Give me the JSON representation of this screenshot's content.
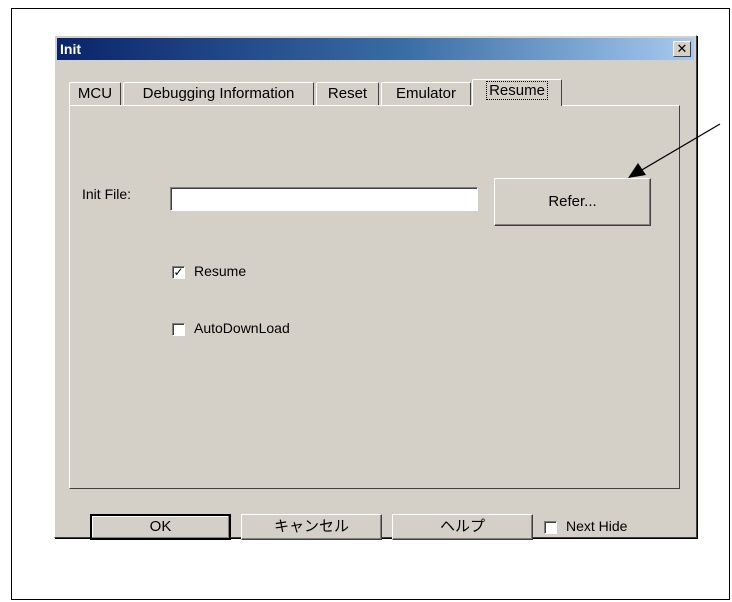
{
  "window": {
    "title": "Init",
    "close_glyph": "✕"
  },
  "tabs": [
    {
      "label": "MCU",
      "active": false
    },
    {
      "label": "Debugging Information",
      "active": false
    },
    {
      "label": "Reset",
      "active": false
    },
    {
      "label": "Emulator",
      "active": false
    },
    {
      "label": "Resume",
      "active": true
    }
  ],
  "resume_panel": {
    "init_file_label": "Init File:",
    "init_file_value": "",
    "refer_label": "Refer...",
    "resume": {
      "label": "Resume",
      "checked": true
    },
    "auto_download": {
      "label": "AutoDownLoad",
      "checked": false
    }
  },
  "footer": {
    "ok_label": "OK",
    "cancel_label": "キャンセル",
    "help_label": "ヘルプ",
    "next_hide": {
      "label": "Next Hide",
      "checked": false
    }
  },
  "colors": {
    "titlebar_start": "#0a246a",
    "titlebar_end": "#a6caf0",
    "dialog_face": "#d4d0c8"
  }
}
